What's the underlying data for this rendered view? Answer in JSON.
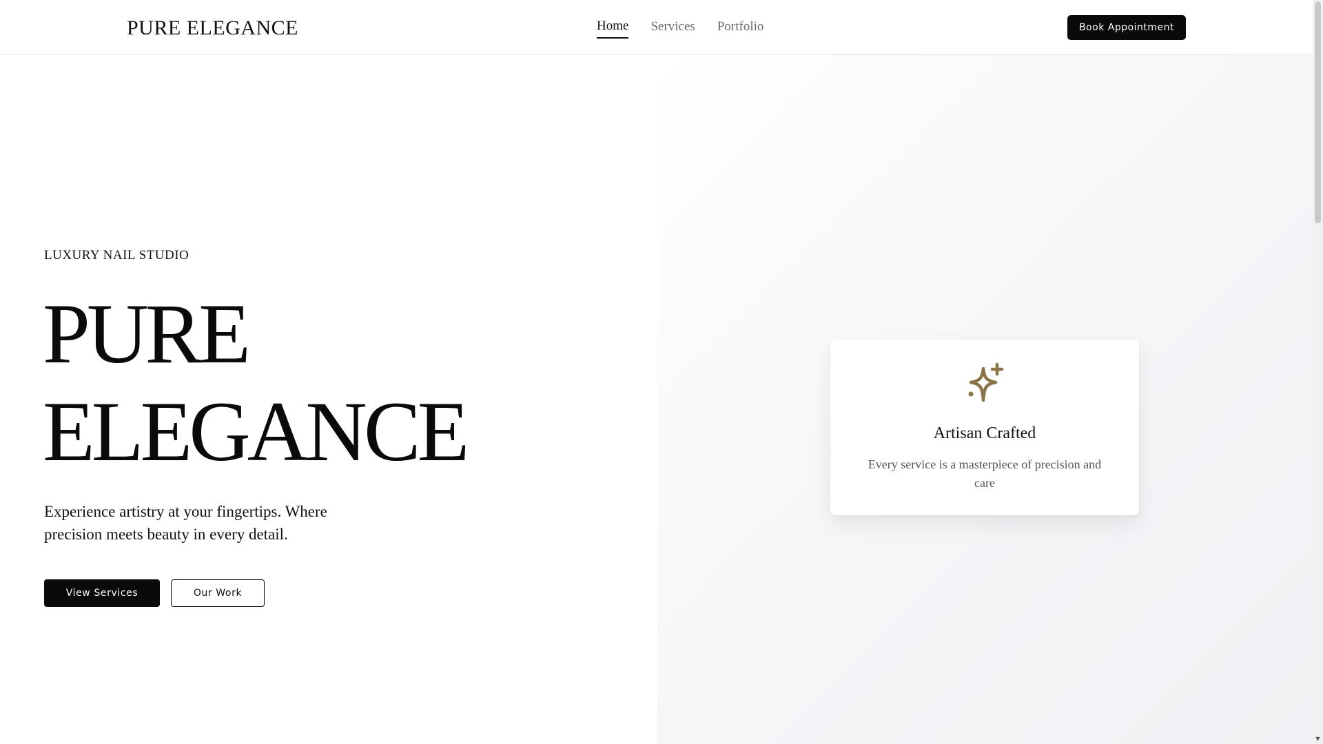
{
  "header": {
    "brand": "PURE ELEGANCE",
    "nav": [
      {
        "label": "Home",
        "active": true
      },
      {
        "label": "Services",
        "active": false
      },
      {
        "label": "Portfolio",
        "active": false
      }
    ],
    "cta_label": "Book Appointment"
  },
  "hero": {
    "eyebrow": "LUXURY NAIL STUDIO",
    "title_line1": "PURE",
    "title_line2": "ELEGANCE",
    "description": "Experience artistry at your fingertips. Where precision meets beauty in every detail.",
    "primary_button": "View Services",
    "secondary_button": "Our Work"
  },
  "feature_card": {
    "icon": "sparkles-icon",
    "title": "Artisan Crafted",
    "text": "Every service is a masterpiece of precision and care"
  },
  "colors": {
    "accent_gold": "#8a7346",
    "primary": "#0a0a0a",
    "muted_text": "#555555"
  }
}
